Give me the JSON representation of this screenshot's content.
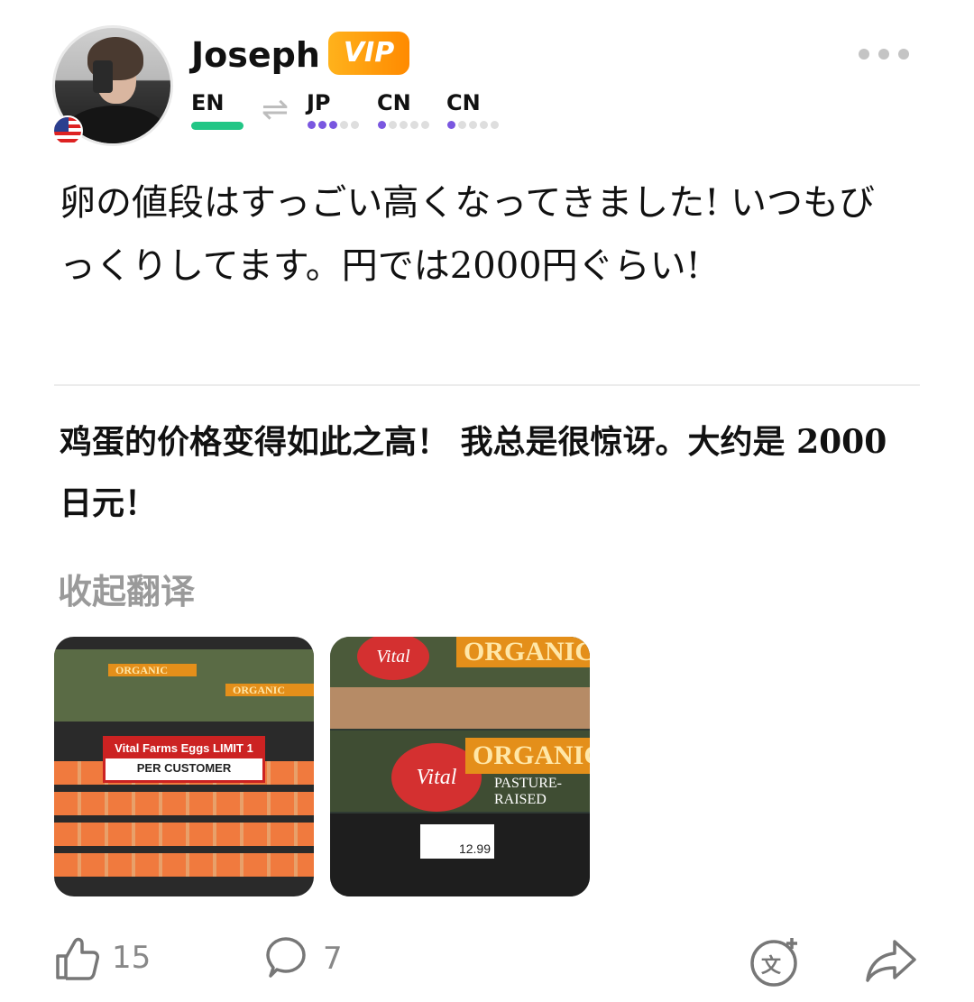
{
  "user": {
    "name": "Joseph",
    "badge": "VIP",
    "flag": "us-flag-icon"
  },
  "languages": {
    "native": "EN",
    "learning": [
      {
        "code": "JP",
        "level": 3,
        "max": 5
      },
      {
        "code": "CN",
        "level": 1,
        "max": 5
      },
      {
        "code": "CN",
        "level": 1,
        "max": 5
      }
    ]
  },
  "post": {
    "original_text": "卵の値段はすっごい高くなってきました! いつもびっくりしてます。円では2000円ぐらい!",
    "translated_text": "鸡蛋的价格变得如此之高！ 我总是很惊讶。大约是 2000 日元！",
    "collapse_translation_label": "收起翻译",
    "images": [
      {
        "sign_line1": "Vital Farms Eggs LIMIT 1",
        "sign_line2": "PER CUSTOMER",
        "carton_label": "ORGANIC"
      },
      {
        "brand": "Vital FARMS",
        "banner": "ORGANIC",
        "subtitle": "PASTURE-RAISED",
        "price": "12.99"
      }
    ]
  },
  "actions": {
    "likes": "15",
    "comments": "7"
  },
  "colors": {
    "vip_gradient_start": "#ffb21c",
    "vip_gradient_end": "#ff8a00",
    "native_bar": "#22c686",
    "level_dot": "#7a57e0",
    "muted": "#9a9a9a"
  }
}
